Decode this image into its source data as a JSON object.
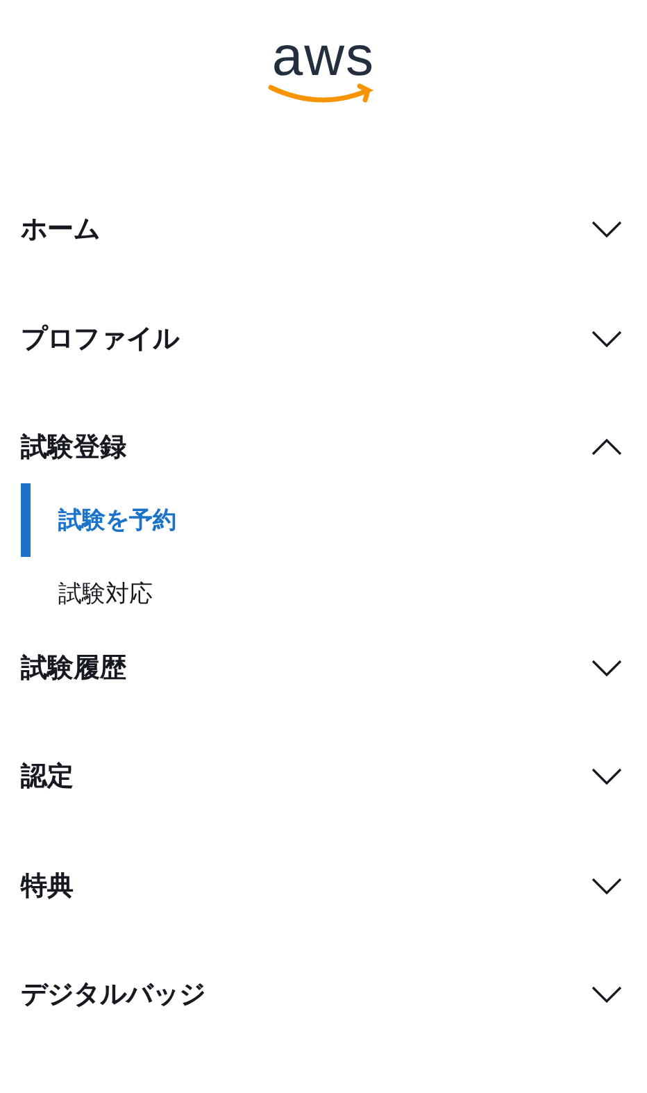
{
  "logo": {
    "text": "aws"
  },
  "nav": [
    {
      "label": "ホーム",
      "expanded": false
    },
    {
      "label": "プロファイル",
      "expanded": false
    },
    {
      "label": "試験登録",
      "expanded": true,
      "children": [
        {
          "label": "試験を予約",
          "selected": true
        },
        {
          "label": "試験対応",
          "selected": false
        }
      ]
    },
    {
      "label": "試験履歴",
      "expanded": false
    },
    {
      "label": "認定",
      "expanded": false
    },
    {
      "label": "特典",
      "expanded": false
    },
    {
      "label": "デジタルバッジ",
      "expanded": false
    }
  ]
}
